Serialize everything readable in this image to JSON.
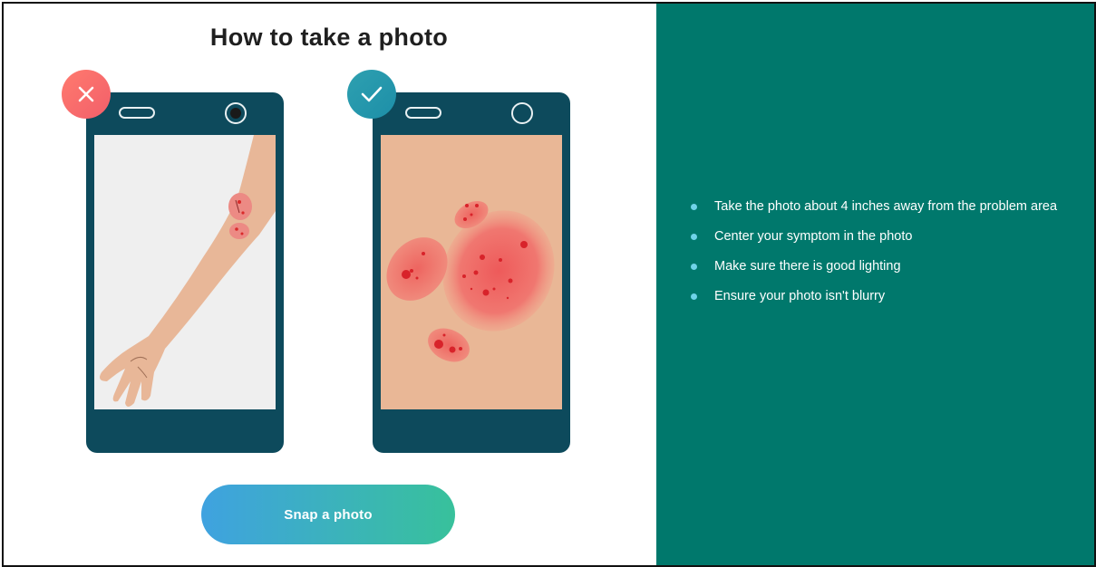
{
  "page": {
    "title": "How to take a photo"
  },
  "examples": {
    "bad": {
      "badge_icon": "x-icon",
      "badge_color": "#f4676c"
    },
    "good": {
      "badge_icon": "checkmark-icon",
      "badge_color": "#2396ad"
    }
  },
  "cta": {
    "label": "Snap a photo"
  },
  "instructions": {
    "items": [
      "Take the photo about 4 inches away from the problem area",
      "Center your symptom in the photo",
      "Make sure there is good lighting",
      "Ensure your photo isn't blurry"
    ]
  },
  "colors": {
    "panel": "#00786c",
    "phone": "#0d4a5c",
    "button_start": "#3fa2e0",
    "button_end": "#38c19b",
    "bullet": "#6fd3e8"
  }
}
